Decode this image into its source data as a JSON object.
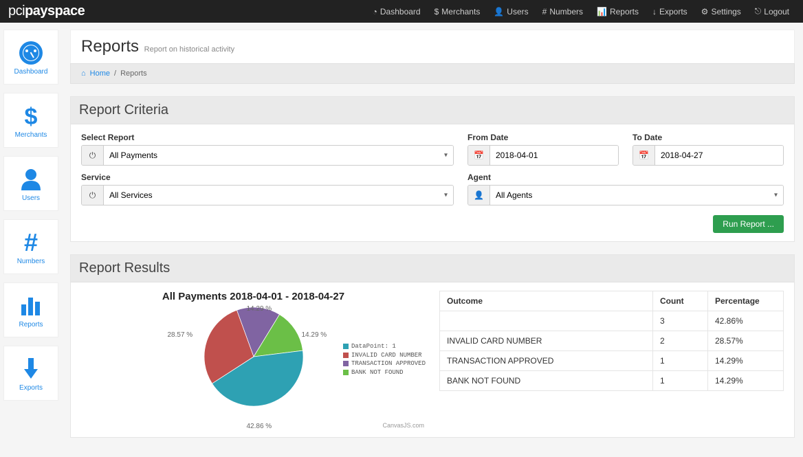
{
  "brand": {
    "plain": "pci",
    "bold": "payspace"
  },
  "topnav": [
    {
      "label": "Dashboard",
      "icon": "dashboard"
    },
    {
      "label": "Merchants",
      "icon": "dollar"
    },
    {
      "label": "Users",
      "icon": "user"
    },
    {
      "label": "Numbers",
      "icon": "hash"
    },
    {
      "label": "Reports",
      "icon": "bars"
    },
    {
      "label": "Exports",
      "icon": "download"
    },
    {
      "label": "Settings",
      "icon": "gear"
    },
    {
      "label": "Logout",
      "icon": "logout"
    }
  ],
  "sidebar": [
    {
      "label": "Dashboard",
      "icon": "dashboard"
    },
    {
      "label": "Merchants",
      "icon": "dollar"
    },
    {
      "label": "Users",
      "icon": "user"
    },
    {
      "label": "Numbers",
      "icon": "hash"
    },
    {
      "label": "Reports",
      "icon": "bars"
    },
    {
      "label": "Exports",
      "icon": "download"
    }
  ],
  "page": {
    "title": "Reports",
    "subtitle": "Report on historical activity"
  },
  "breadcrumb": {
    "home": "Home",
    "current": "Reports"
  },
  "criteria": {
    "heading": "Report Criteria",
    "select_report_label": "Select Report",
    "select_report_value": "All Payments",
    "from_date_label": "From Date",
    "from_date_value": "2018-04-01",
    "to_date_label": "To Date",
    "to_date_value": "2018-04-27",
    "service_label": "Service",
    "service_value": "All Services",
    "agent_label": "Agent",
    "agent_value": "All Agents",
    "run_button": "Run Report ..."
  },
  "results": {
    "heading": "Report Results",
    "chart_title": "All Payments 2018-04-01 - 2018-04-27",
    "chart_credit": "CanvasJS.com",
    "legend": [
      {
        "label": "DataPoint: 1",
        "color": "#2ea1b3"
      },
      {
        "label": "INVALID CARD NUMBER",
        "color": "#c0504d"
      },
      {
        "label": "TRANSACTION APPROVED",
        "color": "#8064a2"
      },
      {
        "label": "BANK NOT FOUND",
        "color": "#6bbf47"
      }
    ],
    "table": {
      "headers": [
        "Outcome",
        "Count",
        "Percentage"
      ],
      "rows": [
        {
          "outcome": "",
          "count": "3",
          "pct": "42.86%"
        },
        {
          "outcome": "INVALID CARD NUMBER",
          "count": "2",
          "pct": "28.57%"
        },
        {
          "outcome": "TRANSACTION APPROVED",
          "count": "1",
          "pct": "14.29%"
        },
        {
          "outcome": "BANK NOT FOUND",
          "count": "1",
          "pct": "14.29%"
        }
      ]
    }
  },
  "chart_data": {
    "type": "pie",
    "title": "All Payments 2018-04-01 - 2018-04-27",
    "series": [
      {
        "name": "DataPoint: 1",
        "value": 42.86,
        "label": "42.86 %",
        "color": "#2ea1b3"
      },
      {
        "name": "INVALID CARD NUMBER",
        "value": 28.57,
        "label": "28.57 %",
        "color": "#c0504d"
      },
      {
        "name": "TRANSACTION APPROVED",
        "value": 14.29,
        "label": "14.29 %",
        "color": "#8064a2"
      },
      {
        "name": "BANK NOT FOUND",
        "value": 14.29,
        "label": "14.29 %",
        "color": "#6bbf47"
      }
    ]
  }
}
